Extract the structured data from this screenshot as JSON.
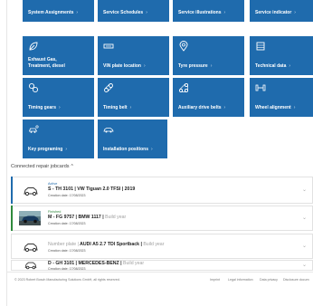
{
  "tiles": [
    {
      "label": "System Assignments",
      "icon": "list-icon"
    },
    {
      "label": "Service Schedules",
      "icon": "calendar-icon"
    },
    {
      "label": "Service illustrations",
      "icon": "image-icon"
    },
    {
      "label": "Service indicator",
      "icon": "gauge-icon"
    },
    {
      "label": "Exhaust Gas, Treatment, diesel",
      "icon": "leaf-icon"
    },
    {
      "label": "VIN plate location",
      "icon": "plate-icon"
    },
    {
      "label": "Tyre pressure",
      "icon": "tyre-pin-icon"
    },
    {
      "label": "Technical data",
      "icon": "chip-icon"
    },
    {
      "label": "Timing gears",
      "icon": "gears-icon"
    },
    {
      "label": "Timing belt",
      "icon": "belt-icon"
    },
    {
      "label": "Auxiliary drive belts",
      "icon": "drive-belt-icon"
    },
    {
      "label": "Wheel alignment",
      "icon": "axle-icon"
    },
    {
      "label": "Key programing",
      "icon": "key-car-icon"
    },
    {
      "label": "Installation positions",
      "icon": "car-side-icon"
    }
  ],
  "connected": {
    "title": "Connected repair jobcards"
  },
  "jobs": [
    {
      "status": "Active",
      "status_color": "#1f6bad",
      "title": "S - TH 3101 | VW Tiguan 2.0 TFSI | 2019",
      "title_extra": "",
      "date": "Creation date: 17/08/2023",
      "accent": "#1f6bad",
      "thumb": "car-outline-icon"
    },
    {
      "status": "Finished",
      "status_color": "#2f8a3d",
      "title": "M - FG 9757 | BMW 1117 |",
      "title_extra": " Build year",
      "date": "Creation date: 17/08/2023",
      "accent": "#2f8a3d",
      "thumb": "car-photo-icon"
    },
    {
      "status": "",
      "status_color": "#999999",
      "title": "",
      "title_muted": "Number plate |",
      "title_mid": " AUDI  A5 2.7 TDI Sportback |",
      "title_extra": " Build year",
      "date": "Creation date: 17/08/2023",
      "accent": "#ffffff",
      "thumb": "car-outline-icon"
    },
    {
      "status": "",
      "status_color": "#999999",
      "title": "D - GH 3101 | MERCEDES-BENZ |",
      "title_extra": " Build year",
      "date": "Creation date: 17/08/2023",
      "accent": "#ffffff",
      "thumb": "car-outline-icon"
    }
  ],
  "footer": {
    "copyright": "© 2023 Robert Bosch Manufacturing Solutions GmbH, all rights reserved.",
    "links": [
      "Imprint",
      "Legal information",
      "Data privacy",
      "Disclosure docum"
    ]
  },
  "colors": {
    "tile": "#1f6bad"
  }
}
